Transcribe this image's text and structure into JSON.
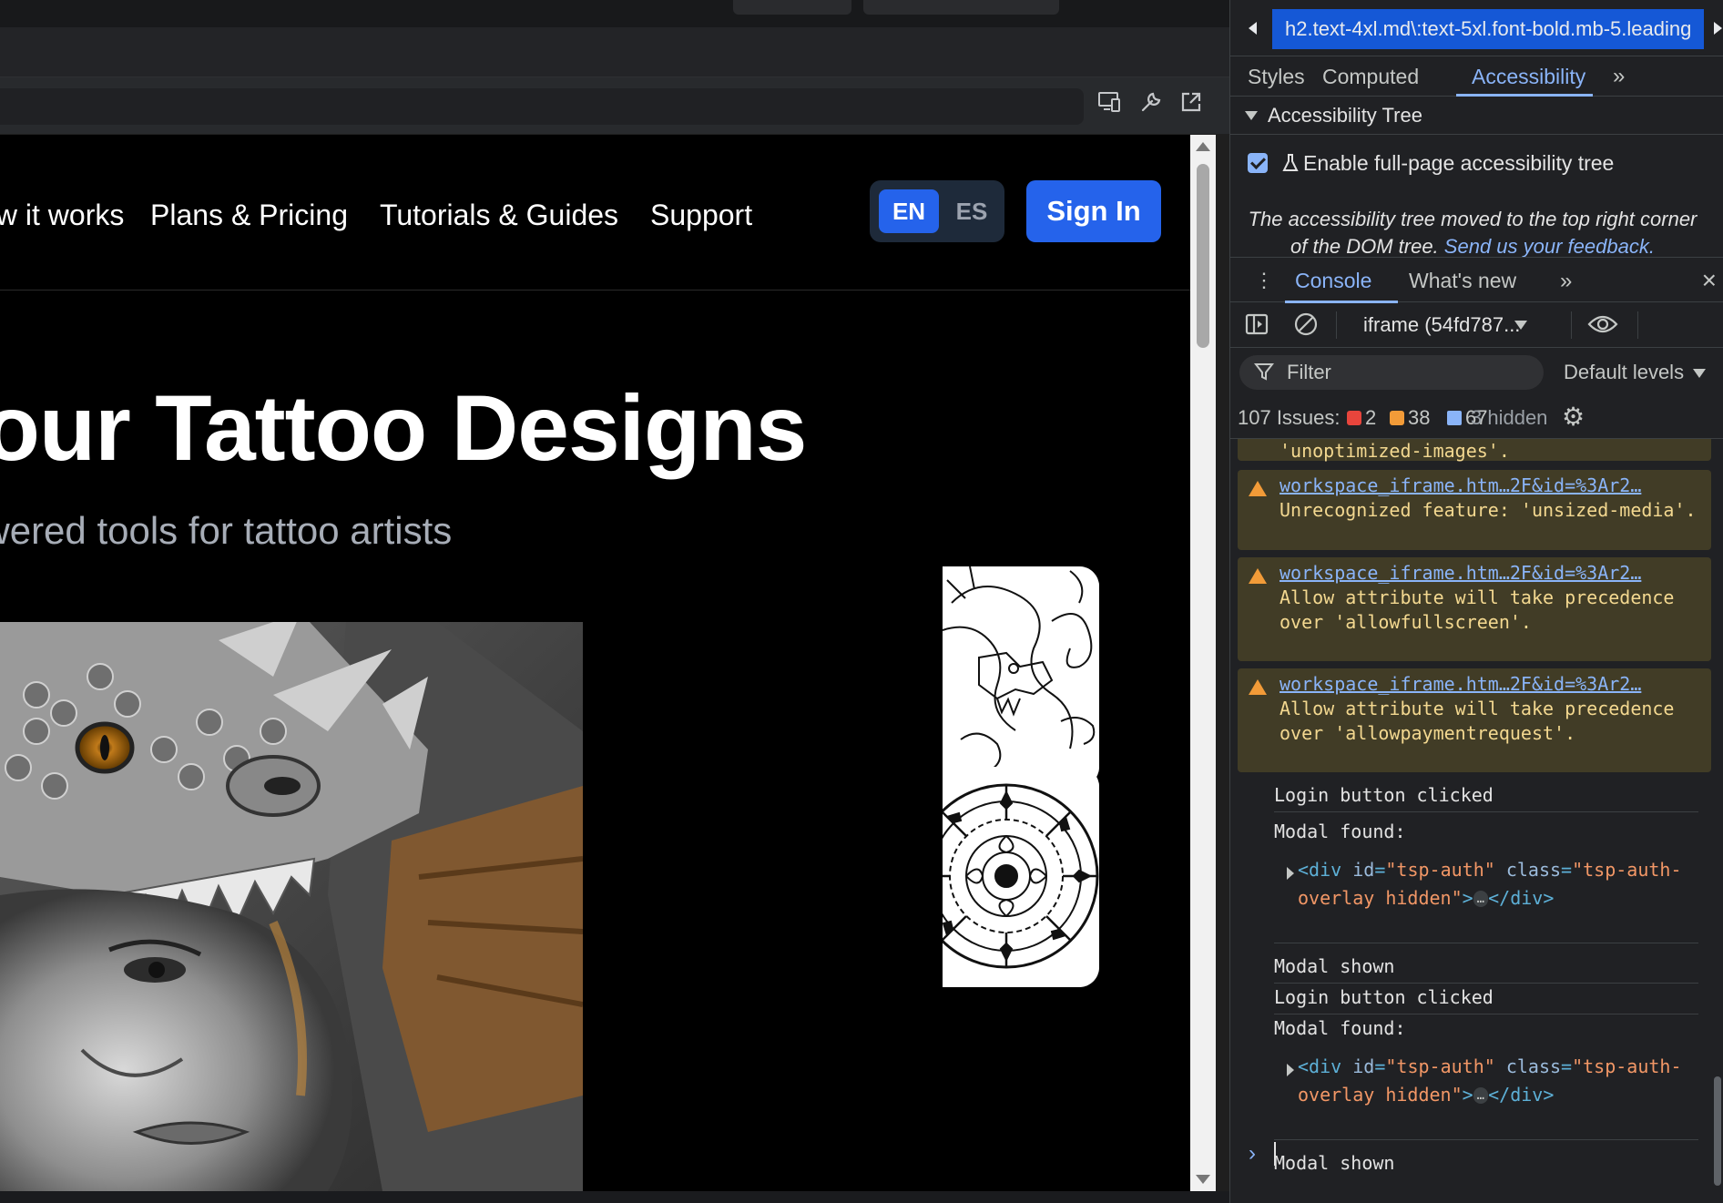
{
  "browser": {
    "toolbar_icons": [
      "device-toolbar-icon",
      "wrench-icon",
      "open-external-icon"
    ]
  },
  "site": {
    "nav": {
      "links": [
        "How it works",
        "Plans & Pricing",
        "Tutorials & Guides",
        "Support"
      ],
      "lang_en": "EN",
      "lang_es": "ES",
      "signin": "Sign In"
    },
    "hero": {
      "title": "Create your Tattoo Designs",
      "subtitle": "AI-powered tools for tattoo artists"
    },
    "colors": {
      "accent": "#2563eb",
      "background": "#000000"
    }
  },
  "devtools": {
    "breadcrumb": "h2.text-4xl.md\\:text-5xl.font-bold.mb-5.leading",
    "tabs": [
      "Styles",
      "Computed",
      "Accessibility"
    ],
    "active_tab": "Accessibility",
    "accessibility": {
      "section": "Accessibility Tree",
      "checkbox_label": "Enable full-page accessibility tree",
      "checkbox_checked": true,
      "note": "The accessibility tree moved to the top right corner of the DOM tree.",
      "feedback_link": "Send us your feedback."
    },
    "drawer_tabs": [
      "Console",
      "What's new"
    ],
    "console": {
      "context": "iframe (54fd787...",
      "filter_placeholder": "Filter",
      "levels": "Default levels",
      "issues_label": "107 Issues:",
      "errors": "2",
      "warnings": "38",
      "info": "67",
      "hidden": "3 hidden",
      "partial_top": "'unoptimized-images'.",
      "warnings_list": [
        {
          "source": "workspace_iframe.htm…2F&id=%3Ar2…",
          "message": "Unrecognized feature: 'unsized-media'."
        },
        {
          "source": "workspace_iframe.htm…2F&id=%3Ar2…",
          "message": "Allow attribute will take precedence over 'allowfullscreen'."
        },
        {
          "source": "workspace_iframe.htm…2F&id=%3Ar2…",
          "message": "Allow attribute will take precedence over 'allowpaymentrequest'."
        }
      ],
      "logs": {
        "login_clicked": "Login button clicked",
        "modal_found": "Modal found:",
        "modal_shown": "Modal shown",
        "div_open": "<div",
        "id_attr": "id",
        "id_val": "\"tsp-auth\"",
        "class_attr": "class",
        "class_val": "\"tsp-auth-overlay hidden\"",
        "close_tag": "</div>"
      }
    }
  }
}
